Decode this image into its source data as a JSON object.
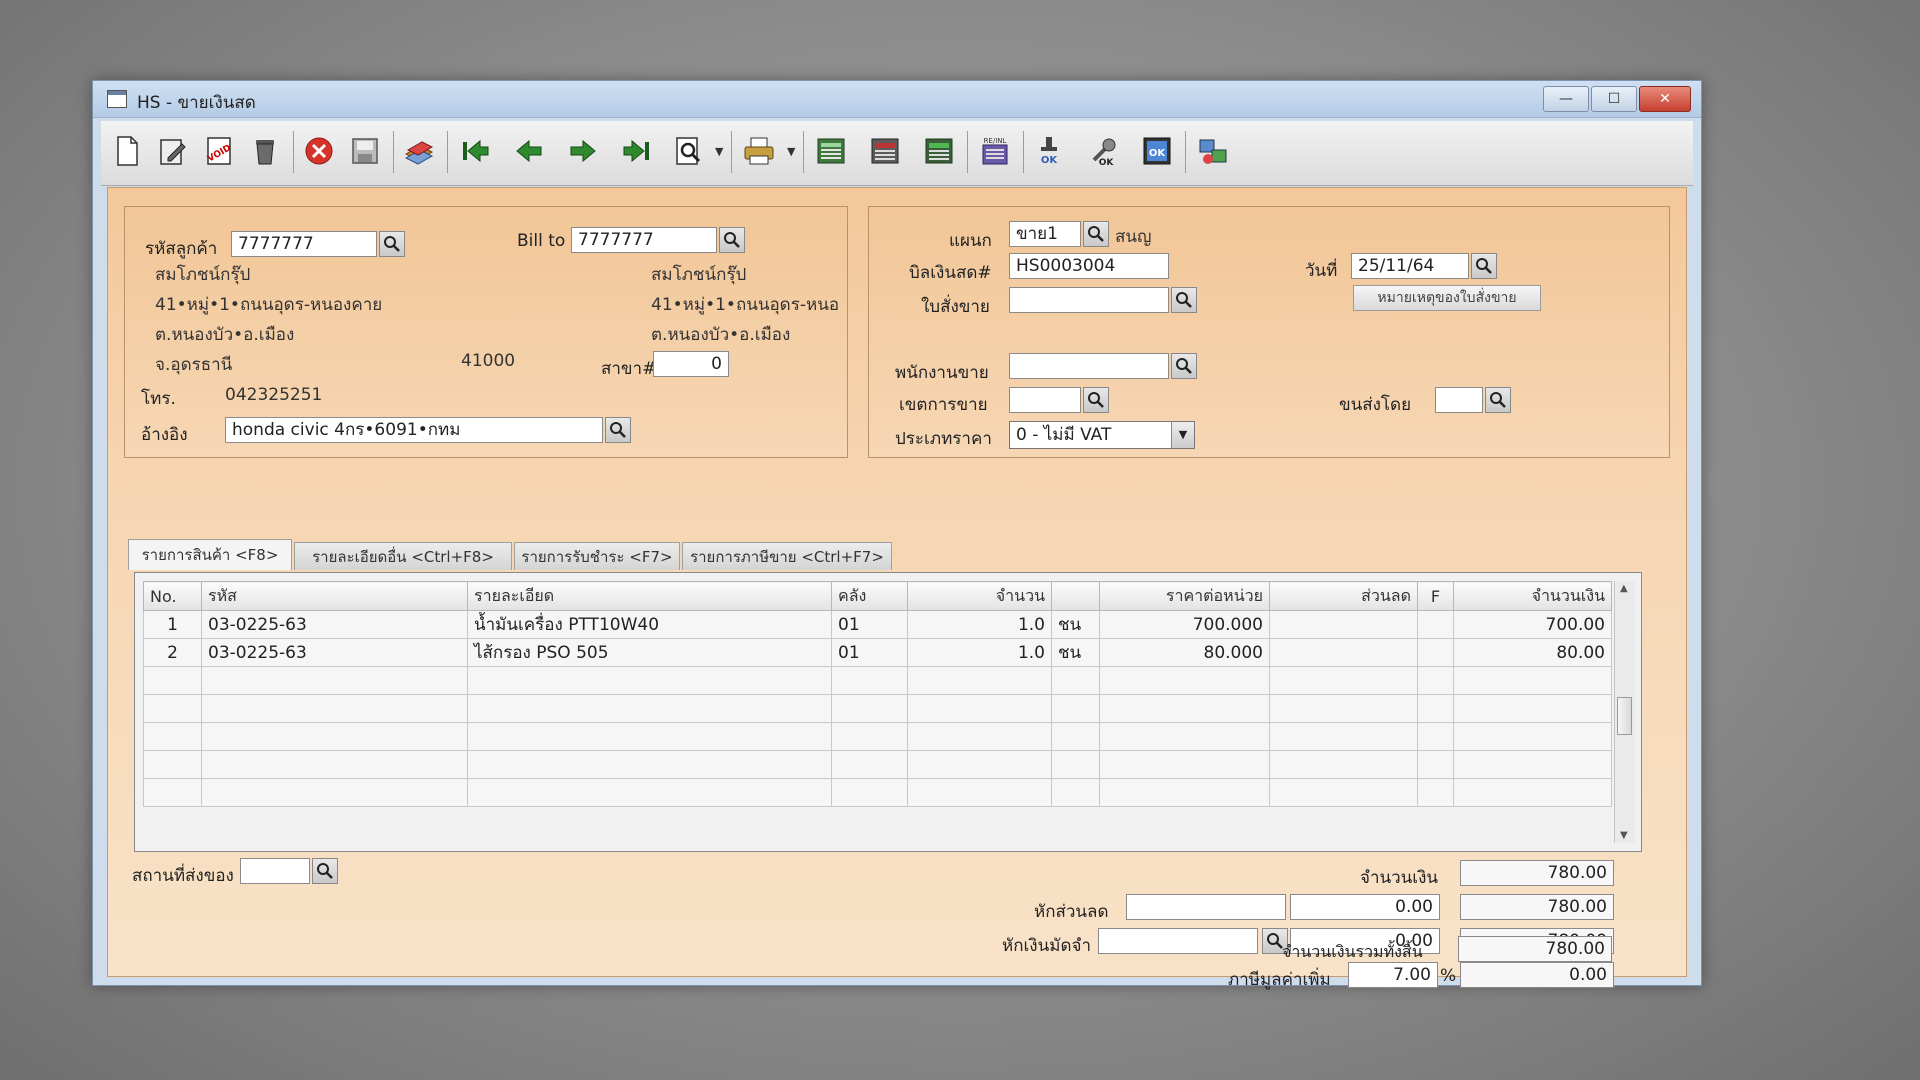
{
  "window": {
    "title": "HS - ขายเงินสด",
    "controls": {
      "minimize": "—",
      "maximize": "☐",
      "close": "✕"
    }
  },
  "toolbar": {
    "icons": [
      "new-document-icon",
      "edit-icon",
      "void-icon",
      "trash-icon",
      "cancel-icon",
      "save-icon",
      "books-icon",
      "first-record-icon",
      "previous-record-icon",
      "next-record-icon",
      "last-record-icon",
      "search-document-icon",
      "printer-icon",
      "report-1-icon",
      "report-2-icon",
      "report-3-icon",
      "report-4-icon",
      "stamp-ok-icon",
      "tools-icon",
      "ok-icon",
      "network-icon"
    ],
    "void_text": "VOID",
    "receipt_text": "RE/INL",
    "ok_text": "OK"
  },
  "customer": {
    "code_label": "รหัสลูกค้า",
    "code_value": "7777777",
    "name": "สมโภชน์กรุ๊ป",
    "address1": "41•หมู่•1•ถนนอุดร-หนองคาย",
    "address2": "ต.หนองบัว•อ.เมือง",
    "province": "จ.อุดรธานี",
    "postcode": "41000",
    "phone_label": "โทร.",
    "phone": "042325251",
    "ref_label": "อ้างอิง",
    "ref_value": "honda civic 4กร•6091•กทม"
  },
  "billto": {
    "label": "Bill to",
    "value": "7777777",
    "name": "สมโภชน์กรุ๊ป",
    "address1": "41•หมู่•1•ถนนอุดร-หนอ",
    "address2": "ต.หนองบัว•อ.เมือง",
    "branch_label": "สาขา#",
    "branch_value": "0"
  },
  "doc": {
    "dept_label": "แผนก",
    "dept_value": "ขาย1",
    "dept_name": "สนญ",
    "bill_label": "บิลเงินสด#",
    "bill_value": "HS0003004",
    "date_label": "วันที่",
    "date_value": "25/11/64",
    "order_label": "ใบสั่งขาย",
    "order_value": "",
    "order_note_button": "หมายเหตุของใบสั่งขาย",
    "salesman_label": "พนักงานขาย",
    "area_label": "เขตการขาย",
    "ship_by_label": "ขนส่งโดย",
    "price_type_label": "ประเภทราคา",
    "price_type_value": "0 - ไม่มี VAT"
  },
  "tabs": [
    {
      "label": "รายการสินค้า <F8>"
    },
    {
      "label": "รายละเอียดอื่น <Ctrl+F8>"
    },
    {
      "label": "รายการรับชำระ <F7>"
    },
    {
      "label": "รายการภาษีขาย <Ctrl+F7>"
    }
  ],
  "grid": {
    "headers": [
      "No.",
      "รหัส",
      "รายละเอียด",
      "คลัง",
      "จำนวน",
      "",
      "ราคาต่อหน่วย",
      "ส่วนลด",
      "F",
      "จำนวนเงิน"
    ],
    "rows": [
      {
        "no": "1",
        "code": "03-0225-63",
        "desc": "น้ำมันเครื่อง PTT10W40",
        "wh": "01",
        "qty": "1.0",
        "unit": "ชน",
        "price": "700.000",
        "disc": "",
        "f": "",
        "amount": "700.00"
      },
      {
        "no": "2",
        "code": "03-0225-63",
        "desc": "ไส้กรอง PSO 505",
        "wh": "01",
        "qty": "1.0",
        "unit": "ชน",
        "price": "80.000",
        "disc": "",
        "f": "",
        "amount": "80.00"
      }
    ]
  },
  "footer": {
    "ship_place_label": "สถานที่ส่งของ",
    "amount_label": "จำนวนเงิน",
    "amount_value": "780.00",
    "discount_label": "หักส่วนลด",
    "discount_value": "0.00",
    "discount_total": "780.00",
    "deposit_label": "หักเงินมัดจำ",
    "deposit_value": "0.00",
    "deposit_total": "780.00",
    "vat_label": "ภาษีมูลค่าเพิ่ม",
    "vat_rate": "7.00",
    "vat_pct": "%",
    "vat_value": "0.00",
    "grand_label": "จำนวนเงินรวมทั้งสิ้น",
    "grand_value": "780.00"
  }
}
